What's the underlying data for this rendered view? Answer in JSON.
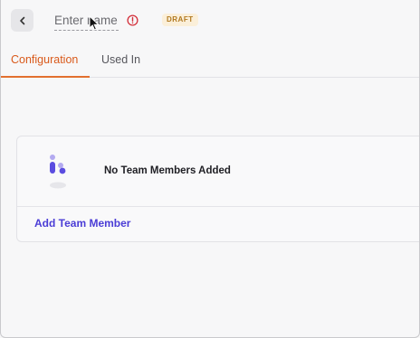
{
  "header": {
    "back_icon": "chevron-left-icon",
    "name_placeholder": "Enter name",
    "warning_icon": "alert-circle-icon",
    "status_badge": "DRAFT"
  },
  "tabs": [
    {
      "label": "Configuration",
      "active": true
    },
    {
      "label": "Used In",
      "active": false
    }
  ],
  "team_members": {
    "empty_icon": "people-icon",
    "empty_message": "No Team Members Added",
    "add_label": "Add Team Member"
  },
  "colors": {
    "accent": "#e2702f",
    "link": "#4b3dd6",
    "warning": "#d32f3a",
    "badge_bg": "#fbefd9",
    "badge_text": "#b1781e"
  }
}
